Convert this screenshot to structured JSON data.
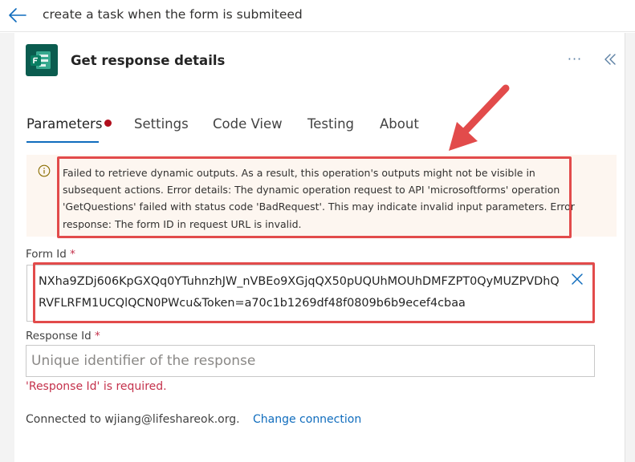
{
  "header": {
    "title": "create a task when the form is submiteed",
    "back_icon": "back-arrow-icon"
  },
  "panel": {
    "title": "Get response details",
    "app_icon": "microsoft-forms-icon",
    "more_label": "···",
    "collapse_icon": "double-chevron-left-icon"
  },
  "tabs": [
    {
      "label": "Parameters",
      "active": true,
      "has_error": true
    },
    {
      "label": "Settings"
    },
    {
      "label": "Code View"
    },
    {
      "label": "Testing"
    },
    {
      "label": "About"
    }
  ],
  "warning": {
    "icon": "info-icon",
    "text": "Failed to retrieve dynamic outputs. As a result, this operation's outputs might not be visible in subsequent actions. Error details: The dynamic operation request to API 'microsoftforms' operation 'GetQuestions' failed with status code 'BadRequest'. This may indicate invalid input parameters. Error response: The form ID in request URL is invalid."
  },
  "form_id": {
    "label": "Form Id",
    "required_mark": "*",
    "value": "NXha9ZDj606KpGXQq0YTuhnzhJW_nVBEo9XGjqQX50pUQUhMOUhDMFZPT0QyMUZPVDhQRVFLRFM1UCQlQCN0PWcu&Token=a70c1b1269df48f0809b6b9ecef4cbaa",
    "clear_icon": "close-icon"
  },
  "response_id": {
    "label": "Response Id",
    "required_mark": "*",
    "placeholder": "Unique identifier of the response",
    "error": "'Response Id' is required."
  },
  "connection": {
    "text": "Connected to wjiang@lifeshareok.org.",
    "link_label": "Change connection"
  },
  "colors": {
    "accent": "#0f6cbd",
    "error": "#c4314b",
    "annotation": "#e24b4b",
    "warning_bg": "#fdf6f0",
    "forms_icon_bg": "#0b5c4f"
  }
}
